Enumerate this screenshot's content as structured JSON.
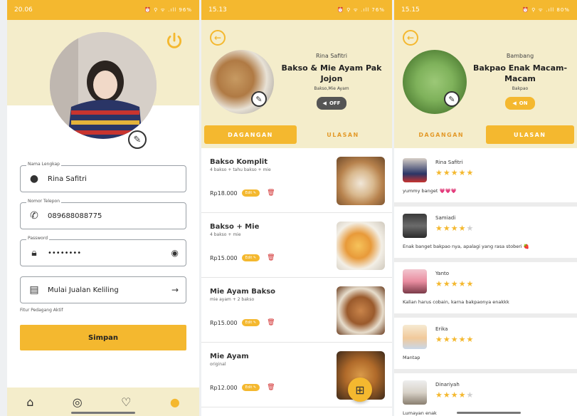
{
  "profile": {
    "status_time": "20.06",
    "status_icons": "⏰ ⚲ ᯤ .ıll 96%",
    "fields": [
      {
        "label": "Nama Lengkap",
        "value": "Rina Safitri"
      },
      {
        "label": "Nomor Telepon",
        "value": "089688088775"
      },
      {
        "label": "Password",
        "value": "••••••••"
      }
    ],
    "jualan_label": "Mulai Jualan Keliling",
    "fitur_text": "Fitur Pedagang Aktif",
    "save_label": "Simpan",
    "nav_icons": [
      "home-icon",
      "compass-icon",
      "heart-icon",
      "user-icon"
    ]
  },
  "store1": {
    "status_time": "15.13",
    "status_icons": "⏰ ⚲ ᯤ .ıll 76%",
    "owner": "Rina Safitri",
    "name": "Bakso & Mie Ayam Pak Jojon",
    "category": "Bakso,Mie Ayam",
    "toggle": "OFF",
    "tab_menu": "DAGANGAN",
    "tab_reviews": "ULASAN",
    "edit_label": "Edit ✎",
    "menu": [
      {
        "name": "Bakso Komplit",
        "desc": "4 bakso + tahu bakso + mie",
        "price": "Rp18.000"
      },
      {
        "name": "Bakso + Mie",
        "desc": "4 bakso + mie",
        "price": "Rp15.000"
      },
      {
        "name": "Mie Ayam Bakso",
        "desc": "mie ayam + 2 bakso",
        "price": "Rp15.000"
      },
      {
        "name": "Mie Ayam",
        "desc": "original",
        "price": "Rp12.000"
      }
    ]
  },
  "store2": {
    "status_time": "15.15",
    "status_icons": "⏰ ⚲ ᯤ .ıll 80%",
    "owner": "Bambang",
    "name": "Bakpao Enak Macam-Macam",
    "category": "Bakpao",
    "toggle": "ON",
    "tab_menu": "DAGANGAN",
    "tab_reviews": "ULASAN",
    "reviews": [
      {
        "name": "Rina Safitri",
        "stars": 5,
        "text": "yummy banget 💗💗💗"
      },
      {
        "name": "Samiadi",
        "stars": 4,
        "text": "Enak banget bakpao nya, apalagi yang rasa stoberi 🍓"
      },
      {
        "name": "Yanto",
        "stars": 5,
        "text": "Kalian harus cobain, karna bakpaonya enakkk"
      },
      {
        "name": "Erika",
        "stars": 5,
        "text": "Mantap"
      },
      {
        "name": "Dinariyah",
        "stars": 4,
        "text": "Lumayan enak"
      }
    ]
  },
  "colors": {
    "accent": "#f4b82f",
    "header_bg": "#f4edcb"
  }
}
